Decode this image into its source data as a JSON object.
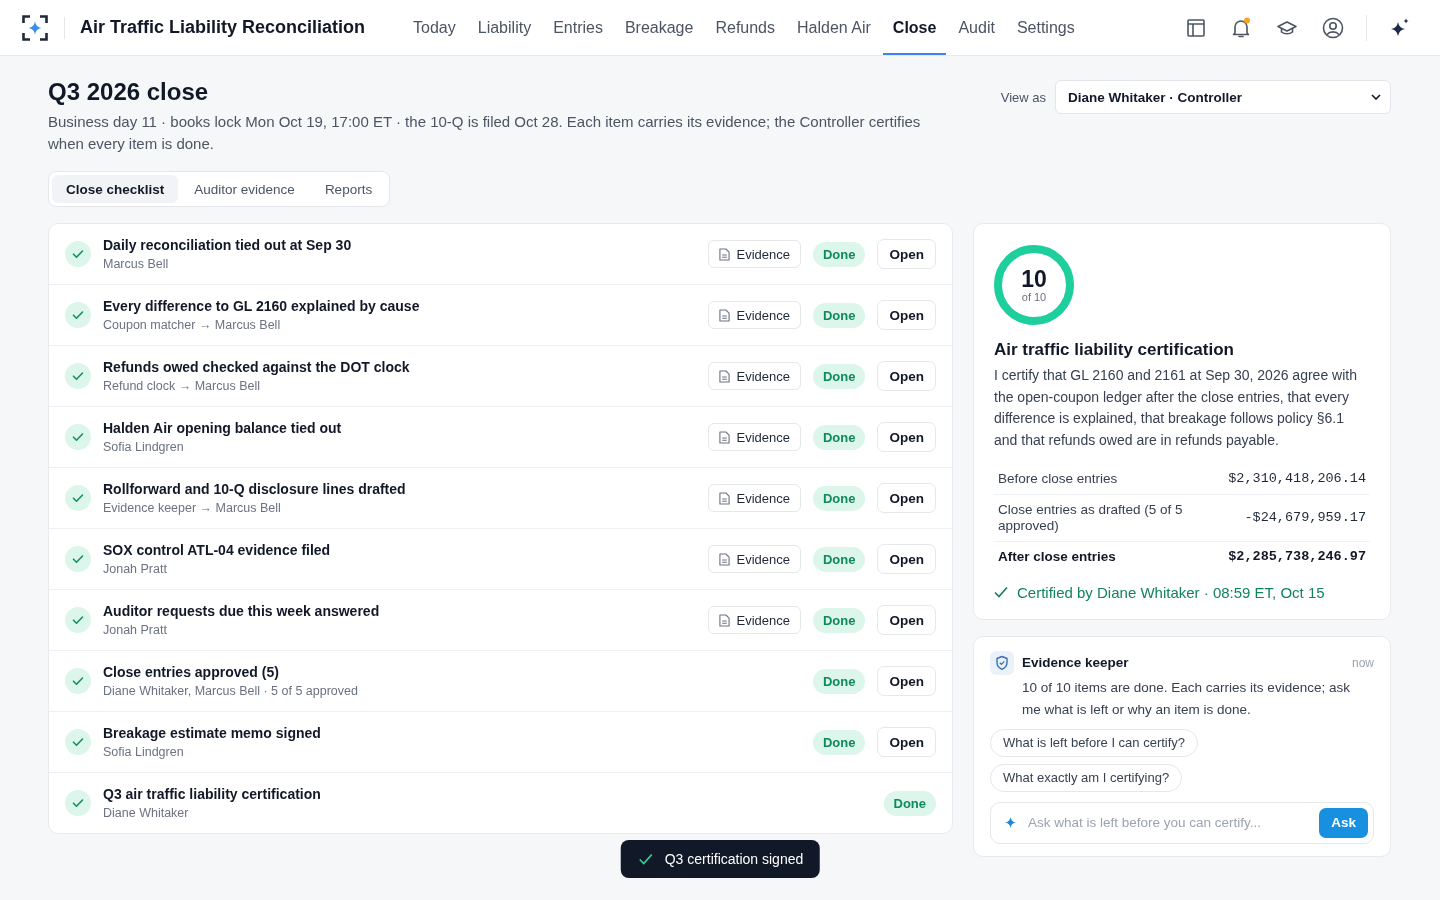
{
  "app": {
    "title": "Air Traffic Liability Reconciliation"
  },
  "nav": [
    {
      "label": "Today",
      "selected": false
    },
    {
      "label": "Liability",
      "selected": false
    },
    {
      "label": "Entries",
      "selected": false
    },
    {
      "label": "Breakage",
      "selected": false
    },
    {
      "label": "Refunds",
      "selected": false
    },
    {
      "label": "Halden Air",
      "selected": false
    },
    {
      "label": "Close",
      "selected": true
    },
    {
      "label": "Audit",
      "selected": false
    },
    {
      "label": "Settings",
      "selected": false
    }
  ],
  "notifications": {
    "unread": true
  },
  "page": {
    "title": "Q3 2026 close",
    "subtitle": "Business day 11 · books lock Mon Oct 19, 17:00 ET · the 10-Q is filed Oct 28. Each item carries its evidence; the Controller certifies when every item is done."
  },
  "view_as": {
    "label": "View as",
    "value": "Diane Whitaker · Controller"
  },
  "tabs": [
    {
      "label": "Close checklist",
      "selected": true
    },
    {
      "label": "Auditor evidence",
      "selected": false
    },
    {
      "label": "Reports",
      "selected": false
    }
  ],
  "checklist": [
    {
      "title": "Daily reconciliation tied out at Sep 30",
      "owner": "Marcus Bell",
      "done": true,
      "evidence_button": "Evidence",
      "status": "Done",
      "open_button": "Open"
    },
    {
      "title": "Every difference to GL 2160 explained by cause",
      "owner": "Coupon matcher → Marcus Bell",
      "done": true,
      "evidence_button": "Evidence",
      "status": "Done",
      "open_button": "Open"
    },
    {
      "title": "Refunds owed checked against the DOT clock",
      "owner": "Refund clock → Marcus Bell",
      "done": true,
      "evidence_button": "Evidence",
      "status": "Done",
      "open_button": "Open"
    },
    {
      "title": "Halden Air opening balance tied out",
      "owner": "Sofia Lindgren",
      "done": true,
      "evidence_button": "Evidence",
      "status": "Done",
      "open_button": "Open"
    },
    {
      "title": "Rollforward and 10-Q disclosure lines drafted",
      "owner": "Evidence keeper → Marcus Bell",
      "done": true,
      "evidence_button": "Evidence",
      "status": "Done",
      "open_button": "Open"
    },
    {
      "title": "SOX control ATL-04 evidence filed",
      "owner": "Jonah Pratt",
      "done": true,
      "evidence_button": "Evidence",
      "status": "Done",
      "open_button": "Open"
    },
    {
      "title": "Auditor requests due this week answered",
      "owner": "Jonah Pratt",
      "done": true,
      "evidence_button": "Evidence",
      "status": "Done",
      "open_button": "Open"
    },
    {
      "title": "Close entries approved (5)",
      "owner": "Diane Whitaker, Marcus Bell · 5 of 5 approved",
      "done": true,
      "status": "Done",
      "open_button": "Open"
    },
    {
      "title": "Breakage estimate memo signed",
      "owner": "Sofia Lindgren",
      "done": true,
      "status": "Done",
      "open_button": "Open"
    },
    {
      "title": "Q3 air traffic liability certification",
      "owner": "Diane Whitaker",
      "done": true,
      "status": "Done"
    }
  ],
  "certification": {
    "progress": {
      "count": "10",
      "caption": "of 10",
      "level": 1
    },
    "title": "Air traffic liability certification",
    "statement": "I certify that GL 2160 and 2161 at Sep 30, 2026 agree with the open-coupon ledger after the close entries, that every difference is explained, that breakage follows policy §6.1 and that refunds owed are in refunds payable.",
    "totals": [
      {
        "kind": "line",
        "label": "Before close entries",
        "amount": "$2,310,418,206.14"
      },
      {
        "kind": "line",
        "label": "Close entries as drafted (5 of 5 approved)",
        "amount": "-$24,679,959.17"
      },
      {
        "kind": "total",
        "label": "After close entries",
        "amount": "$2,285,738,246.97"
      }
    ],
    "certified": "Certified by Diane Whitaker · 08:59 ET, Oct 15"
  },
  "assistant": {
    "name": "Evidence keeper",
    "time": "now",
    "message": "10 of 10 items are done. Each carries its evidence; ask me what is left or why an item is done.",
    "suggestions": [
      "What is left before I can certify?",
      "What exactly am I certifying?"
    ],
    "input": {
      "placeholder": "Ask what is left before you can certify..."
    },
    "send_button": "Ask"
  },
  "toast": {
    "message": "Q3 certification signed"
  }
}
